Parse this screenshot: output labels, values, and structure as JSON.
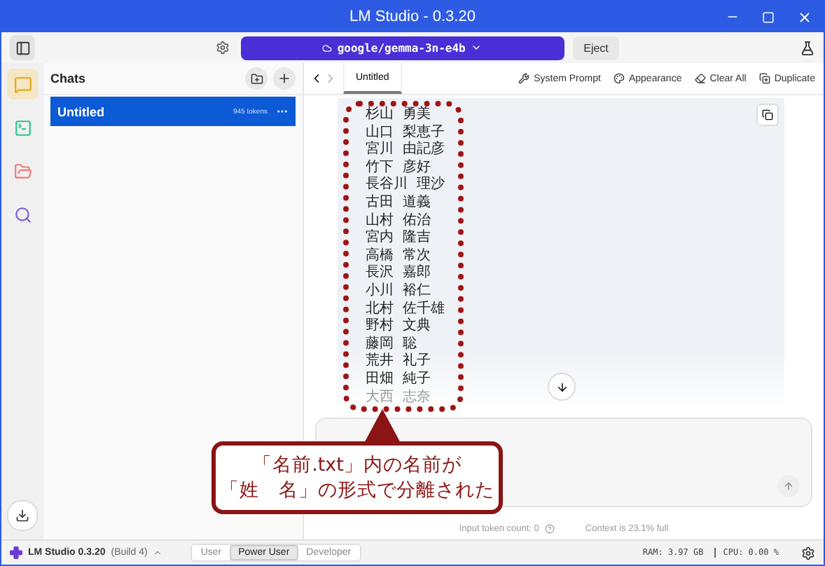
{
  "window": {
    "title": "LM Studio - 0.3.20"
  },
  "toolbar": {
    "model": "google/gemma-3n-e4b",
    "eject": "Eject"
  },
  "rail": [
    {
      "kind": "chat",
      "selected": true
    },
    {
      "kind": "terminal",
      "selected": false
    },
    {
      "kind": "folder",
      "selected": false
    },
    {
      "kind": "search",
      "selected": false
    }
  ],
  "chats": {
    "title": "Chats",
    "items": [
      {
        "name": "Untitled",
        "tokens": "945 tokens",
        "selected": true
      }
    ]
  },
  "tabs": [
    {
      "label": "Untitled",
      "selected": true
    }
  ],
  "actions": [
    {
      "kind": "prompt",
      "label": "System Prompt"
    },
    {
      "kind": "appearance",
      "label": "Appearance"
    },
    {
      "kind": "clear",
      "label": "Clear All"
    },
    {
      "kind": "duplicate",
      "label": "Duplicate"
    }
  ],
  "message": {
    "lines": [
      "杉山  勇美",
      "山口  梨恵子",
      "宮川  由記彦",
      "竹下  彦好",
      "長谷川  理沙",
      "古田  道義",
      "山村  佑治",
      "宮内  隆吉",
      "高橋  常次",
      "長沢  嘉郎",
      "小川  裕仁",
      "北村  佐千雄",
      "野村  文典",
      "藤岡  聡",
      "荒井  礼子",
      "田畑  純子",
      "大西  志奈"
    ]
  },
  "callout": {
    "lines": [
      "「名前.txt」内の名前が",
      "「姓　名」の形式で分離された"
    ]
  },
  "footer": {
    "token_count": "Input token count: 0",
    "context": "Context is 23.1% full"
  },
  "status_bar": {
    "app": "LM Studio 0.3.20",
    "build": "(Build 4)",
    "modes": [
      {
        "label": "User",
        "selected": false
      },
      {
        "label": "Power User",
        "selected": true
      },
      {
        "label": "Developer",
        "selected": false
      }
    ],
    "ram": "RAM: 3.97 GB",
    "cpu": "CPU: 0.00 %"
  }
}
